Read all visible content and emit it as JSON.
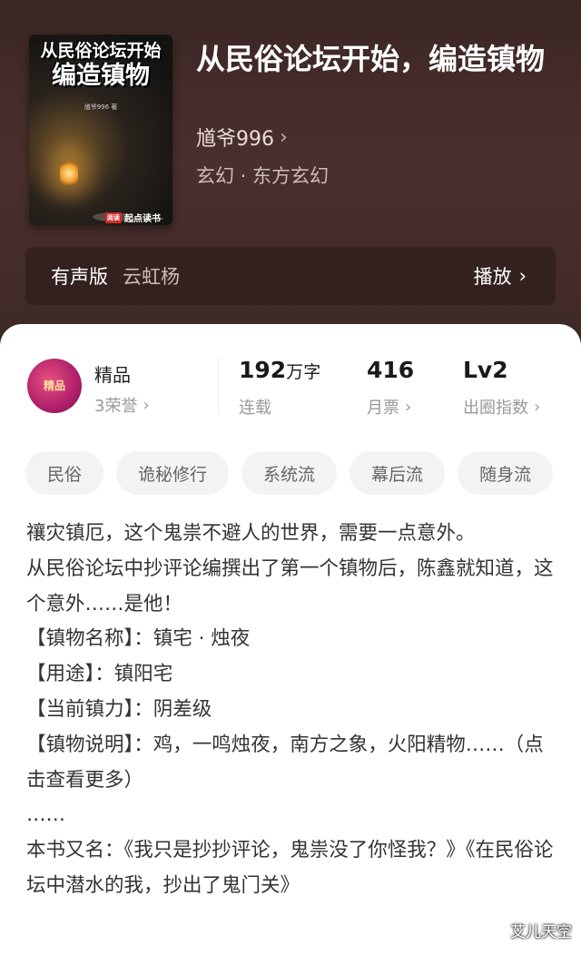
{
  "book": {
    "cover": {
      "title_line1": "从民俗论坛开始",
      "title_line2": "编造镇物",
      "author_small": "馗爷996 著",
      "publisher": "起点读书",
      "publisher_badge": "阅读"
    },
    "title": "从民俗论坛开始，编造镇物",
    "author": "馗爷996",
    "genre": "玄幻 · 东方玄幻"
  },
  "audio": {
    "label": "有声版",
    "narrator": "云虹杨",
    "play": "播放"
  },
  "stats": {
    "badge_text": "精品",
    "quality_label": "精品",
    "honors": "3荣誉",
    "word_count": "192",
    "word_unit": "万字",
    "status": "连载",
    "monthly_votes": "416",
    "monthly_votes_label": "月票",
    "level": "Lv2",
    "level_label": "出圈指数"
  },
  "tags": [
    "民俗",
    "诡秘修行",
    "系统流",
    "幕后流",
    "随身流"
  ],
  "description": [
    "禳灾镇厄，这个鬼祟不避人的世界，需要一点意外。",
    "从民俗论坛中抄评论编撰出了第一个镇物后，陈鑫就知道，这个意外……是他！",
    "【镇物名称】：镇宅 · 烛夜",
    "【用途】：镇阳宅",
    "【当前镇力】：阴差级",
    "【镇物说明】：鸡，一鸣烛夜，南方之象，火阳精物……（点击查看更多）",
    "……",
    "本书又名：《我只是抄抄评论，鬼祟没了你怪我？》《在民俗论坛中潜水的我，抄出了鬼门关》"
  ],
  "watermark": "艾儿天空",
  "icons": {
    "chevron": "chevron-right-icon"
  }
}
